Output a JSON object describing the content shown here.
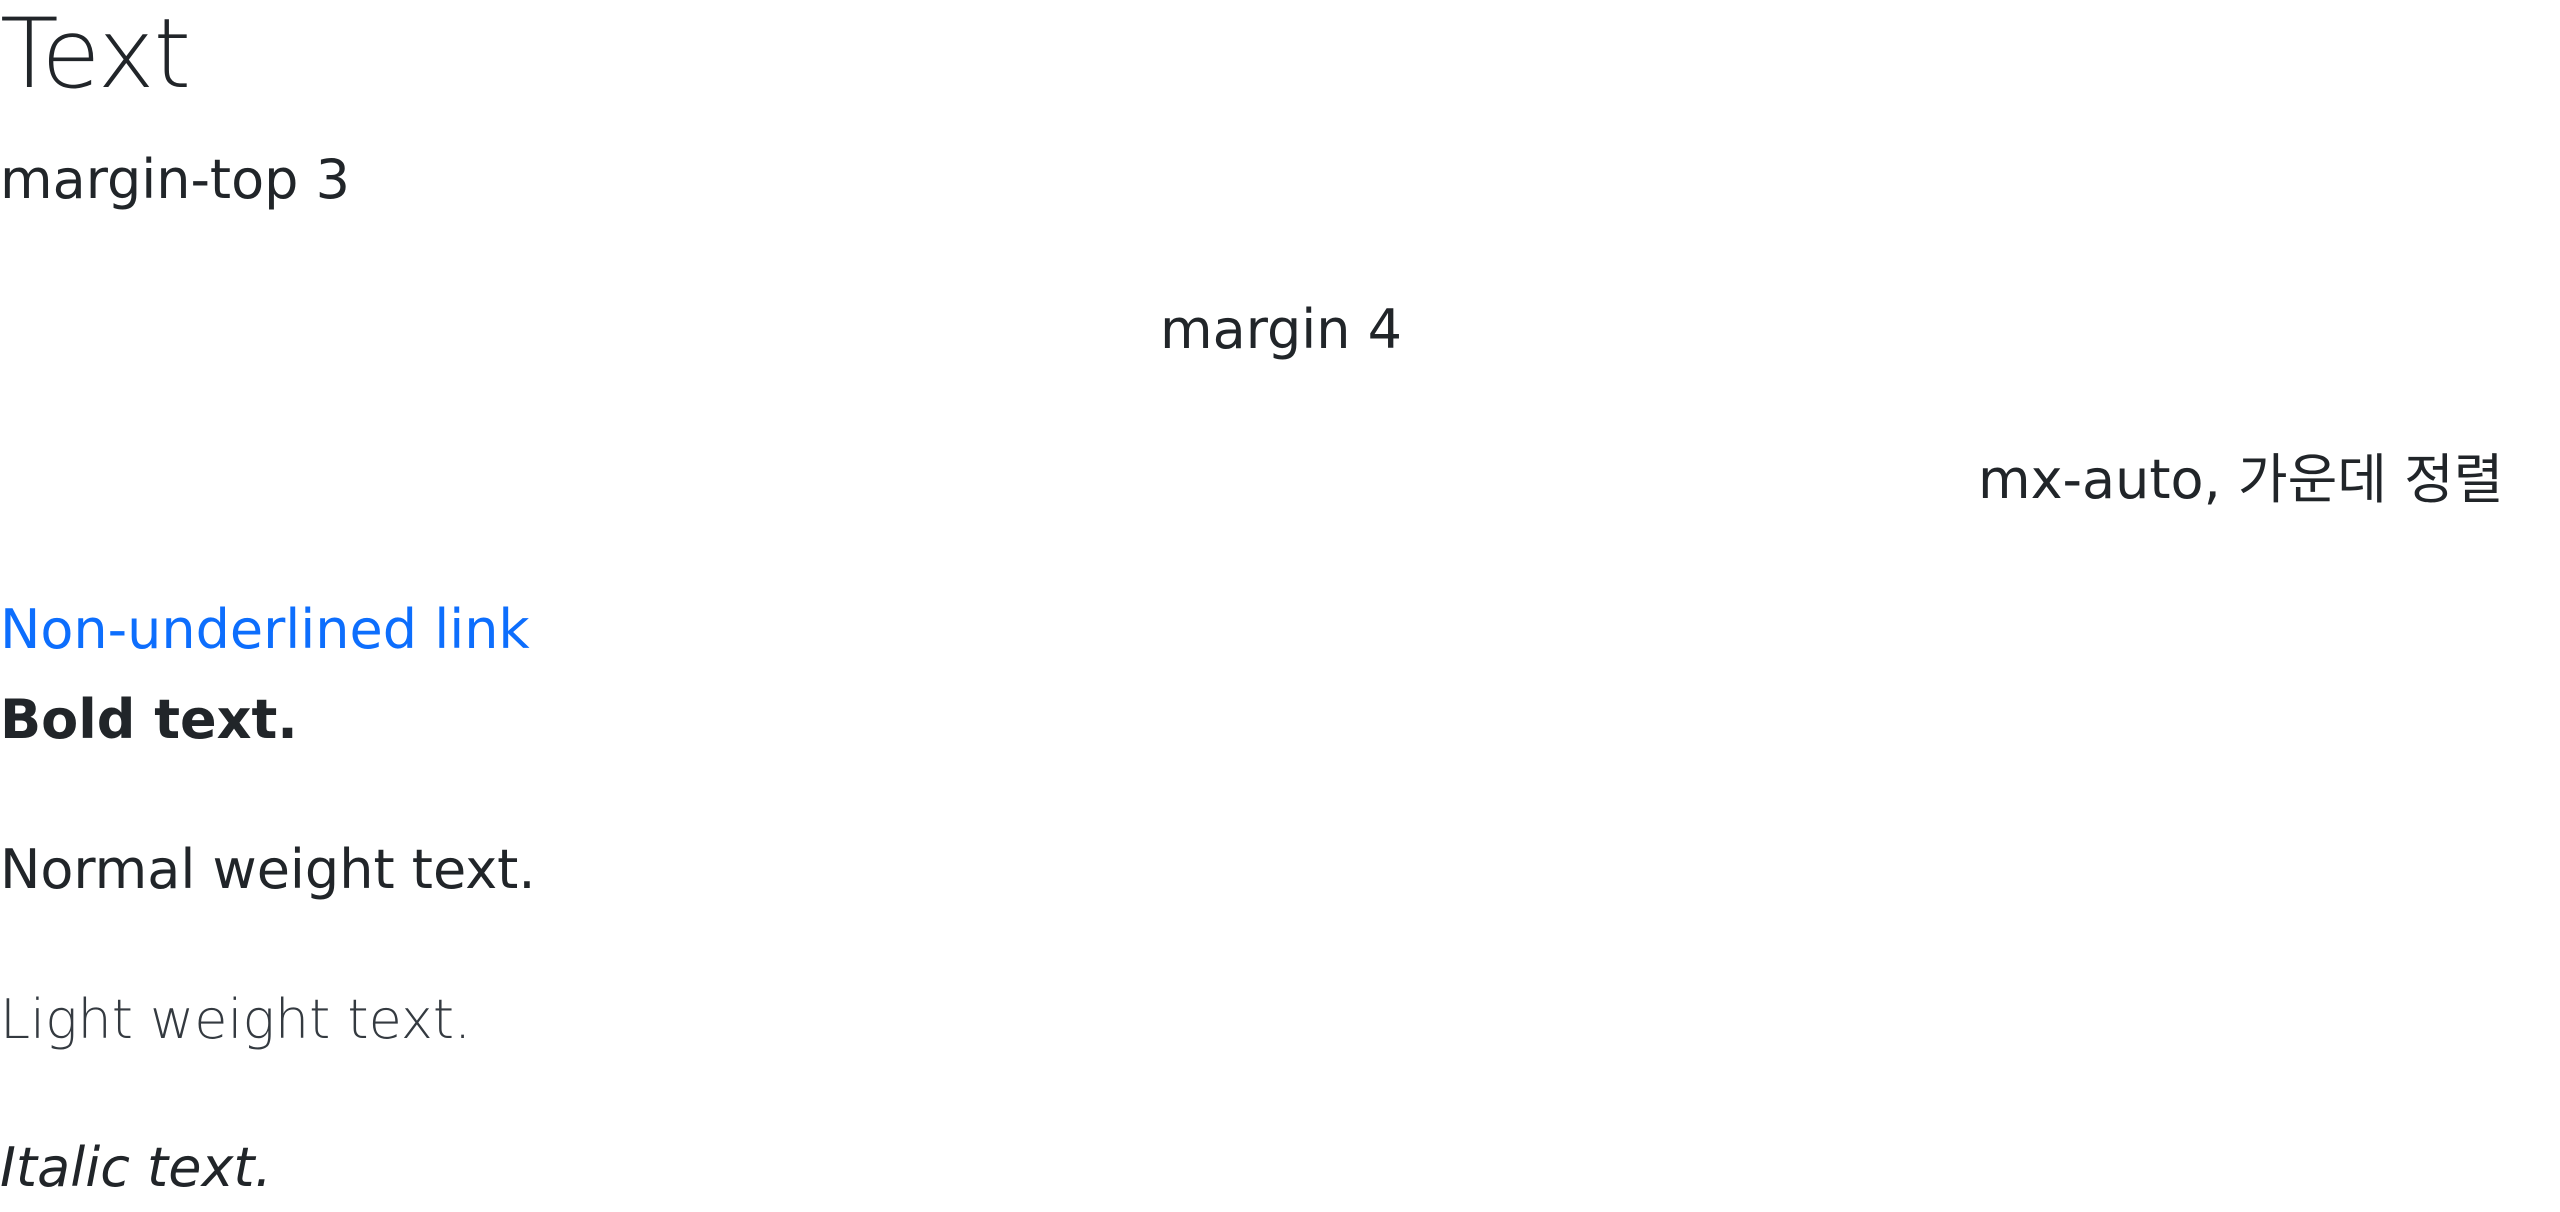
{
  "page": {
    "title": "Text"
  },
  "lines": {
    "margin_top_3": "margin-top 3",
    "margin_4": "margin 4",
    "mx_auto_center": "mx-auto, 가운데 정렬",
    "link": "Non-underlined link",
    "bold": "Bold text.",
    "normal": "Normal weight text.",
    "light": "Light weight text.",
    "italic": "Italic text."
  },
  "colors": {
    "text": "#212529",
    "link": "#0d6efd",
    "background": "#ffffff"
  }
}
